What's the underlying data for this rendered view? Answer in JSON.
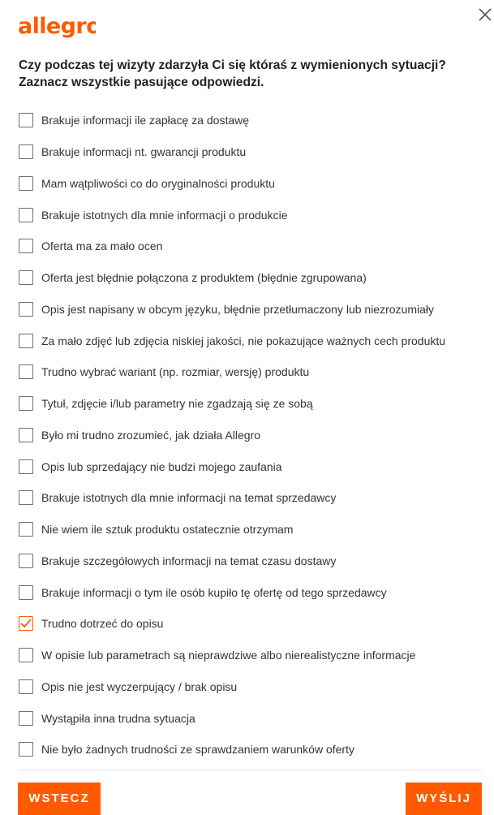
{
  "brand": {
    "logo_text": "allegro",
    "color": "#ff5a00"
  },
  "dialog": {
    "close_icon": "close-icon",
    "question_line1": "Czy podczas tej wizyty zdarzyła Ci się któraś z wymienionych sytuacji?",
    "question_line2": "Zaznacz wszystkie pasujące odpowiedzi."
  },
  "options": [
    {
      "label": "Brakuje informacji ile zapłacę za dostawę",
      "checked": false
    },
    {
      "label": "Brakuje informacji nt. gwarancji produktu",
      "checked": false
    },
    {
      "label": "Mam wątpliwości co do oryginalności produktu",
      "checked": false
    },
    {
      "label": "Brakuje istotnych dla mnie informacji o produkcie",
      "checked": false
    },
    {
      "label": "Oferta ma za mało ocen",
      "checked": false
    },
    {
      "label": "Oferta jest błędnie połączona z produktem (błędnie zgrupowana)",
      "checked": false
    },
    {
      "label": "Opis jest napisany w obcym języku, błędnie przetłumaczony lub niezrozumiały",
      "checked": false
    },
    {
      "label": "Za mało zdjęć lub zdjęcia niskiej jakości, nie pokazujące ważnych cech produktu",
      "checked": false
    },
    {
      "label": "Trudno wybrać wariant (np. rozmiar, wersję) produktu",
      "checked": false
    },
    {
      "label": "Tytuł, zdjęcie i/lub parametry nie zgadzają się ze sobą",
      "checked": false
    },
    {
      "label": "Było mi trudno zrozumieć, jak działa Allegro",
      "checked": false
    },
    {
      "label": "Opis lub sprzedający nie budzi mojego zaufania",
      "checked": false
    },
    {
      "label": "Brakuje istotnych dla mnie informacji na temat sprzedawcy",
      "checked": false
    },
    {
      "label": "Nie wiem ile sztuk produktu ostatecznie otrzymam",
      "checked": false
    },
    {
      "label": "Brakuje szczegółowych informacji na temat czasu dostawy",
      "checked": false
    },
    {
      "label": "Brakuje informacji o tym ile osób kupiło tę ofertę od tego sprzedawcy",
      "checked": false
    },
    {
      "label": "Trudno dotrzeć do opisu",
      "checked": true
    },
    {
      "label": "W opisie lub parametrach są nieprawdziwe albo nierealistyczne informacje",
      "checked": false
    },
    {
      "label": "Opis nie jest wyczerpujący / brak opisu",
      "checked": false
    },
    {
      "label": "Wystąpiła inna trudna sytuacja",
      "checked": false
    },
    {
      "label": "Nie było żadnych trudności ze sprawdzaniem warunków oferty",
      "checked": false
    }
  ],
  "buttons": {
    "back_label": "WSTECZ",
    "send_label": "WYŚLIJ"
  },
  "colors": {
    "accent": "#ff5a00",
    "text": "#222222",
    "checkbox_border": "#6f6f6f"
  }
}
